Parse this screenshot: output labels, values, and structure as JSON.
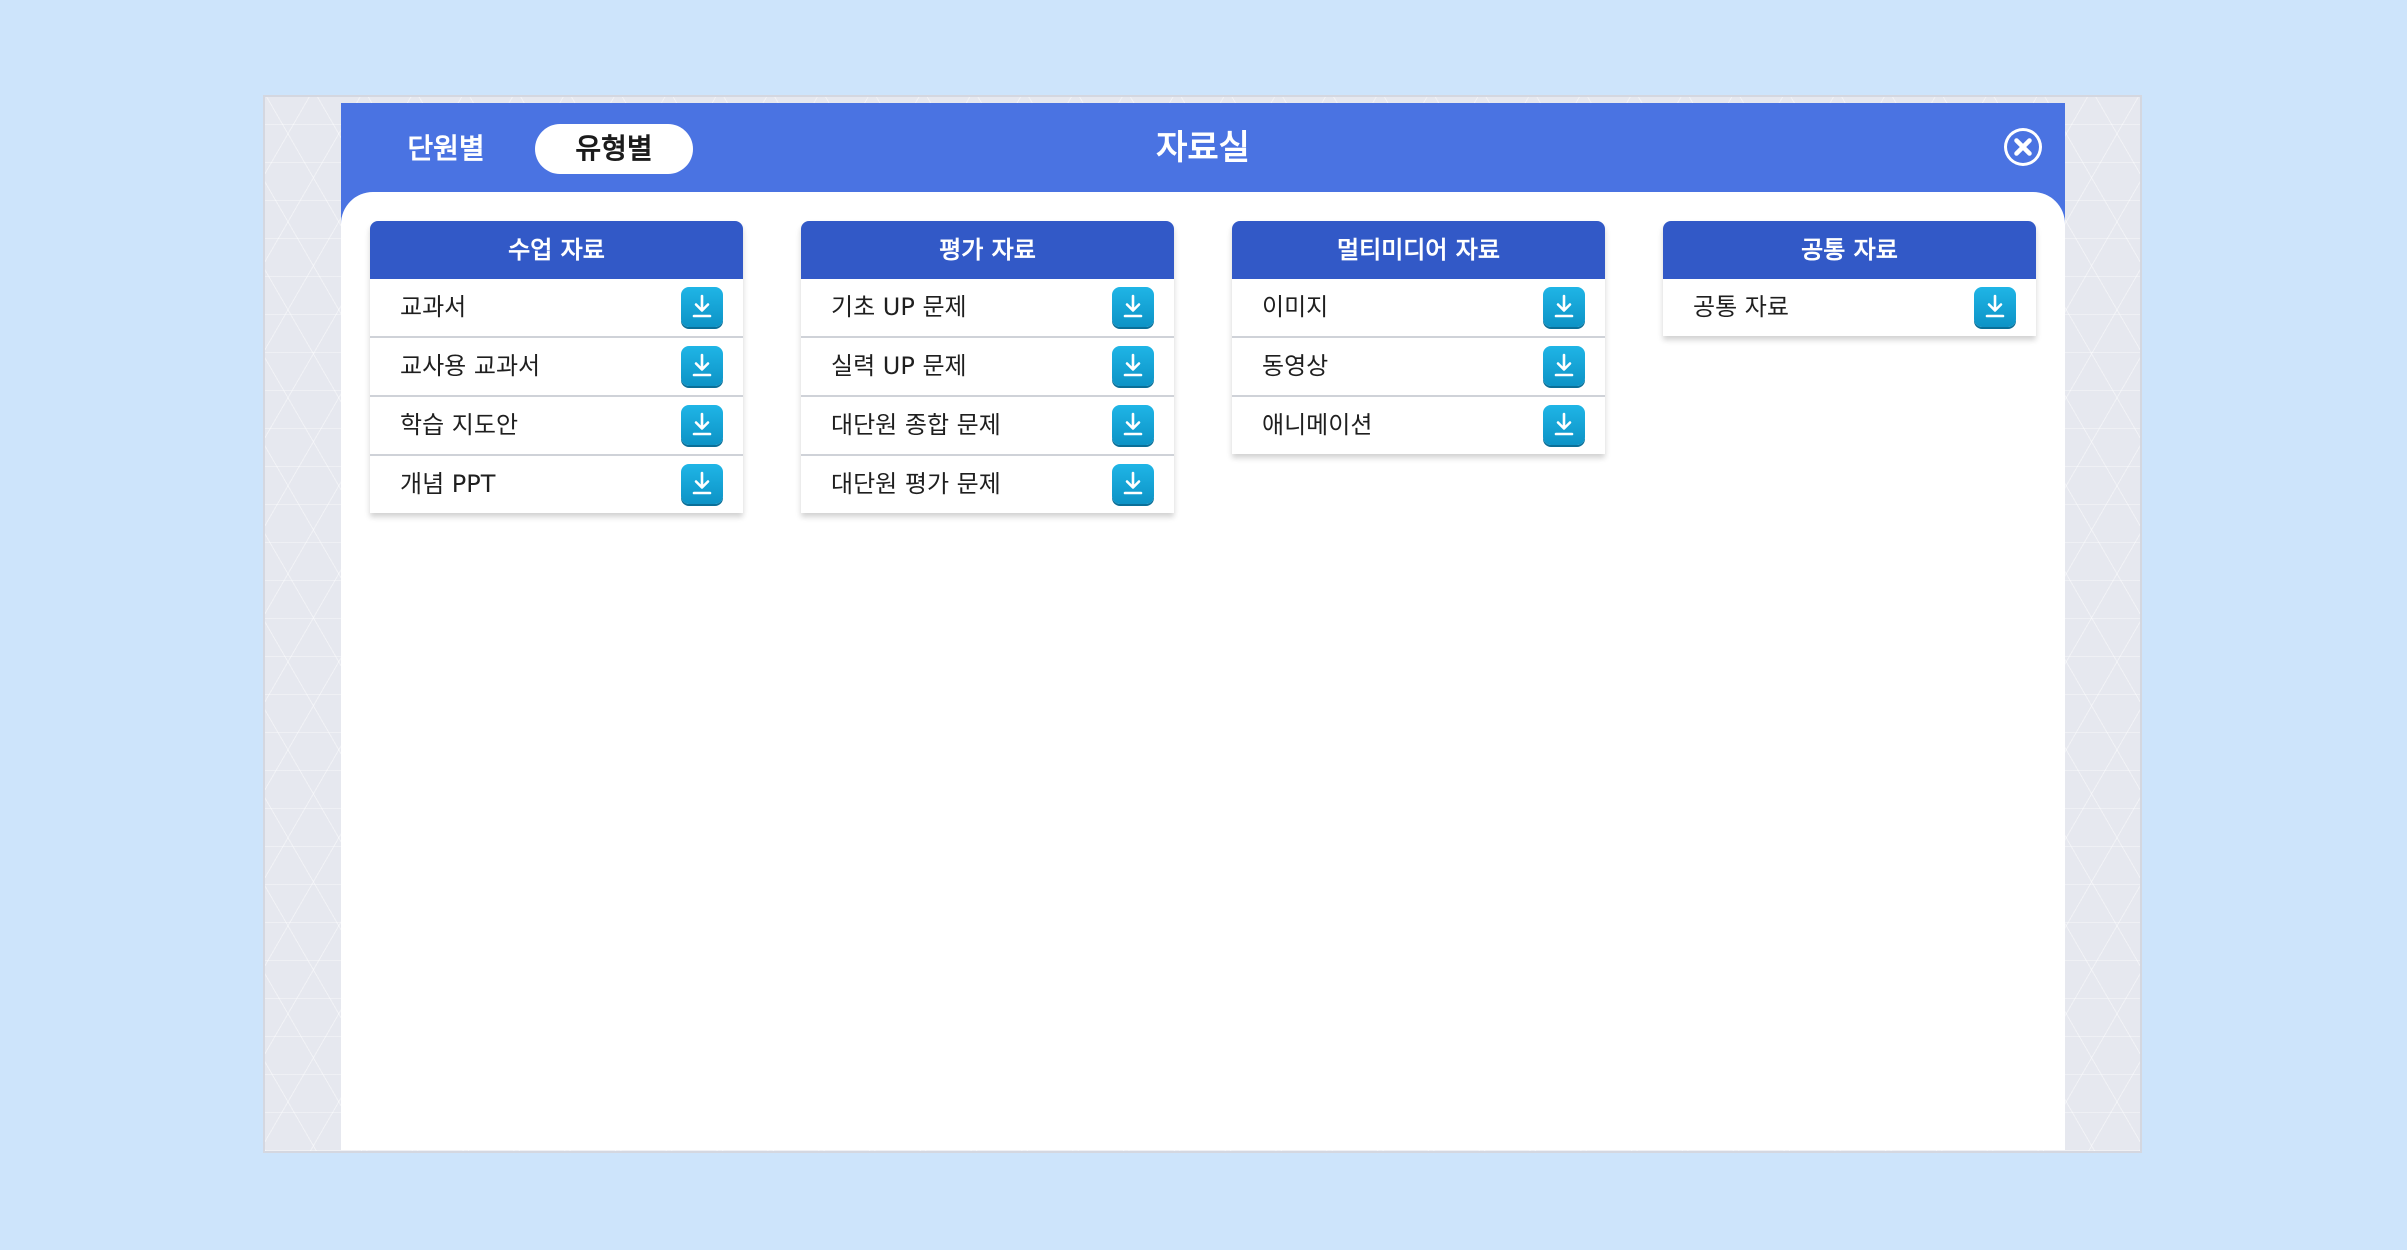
{
  "header": {
    "tabs": [
      {
        "label": "단원별",
        "active": false
      },
      {
        "label": "유형별",
        "active": true
      }
    ],
    "title": "자료실",
    "close_icon": "close-circle-icon"
  },
  "colors": {
    "page_background": "#cde4fb",
    "header_blue": "#4a73e2",
    "column_header_blue": "#3259c7",
    "download_button": "#1aa7d9"
  },
  "columns": [
    {
      "title": "수업 자료",
      "items": [
        {
          "label": "교과서",
          "icon": "download-icon"
        },
        {
          "label": "교사용 교과서",
          "icon": "download-icon"
        },
        {
          "label": "학습 지도안",
          "icon": "download-icon"
        },
        {
          "label": "개념 PPT",
          "icon": "download-icon"
        }
      ]
    },
    {
      "title": "평가 자료",
      "items": [
        {
          "label": "기초 UP 문제",
          "icon": "download-icon"
        },
        {
          "label": "실력 UP 문제",
          "icon": "download-icon"
        },
        {
          "label": "대단원 종합 문제",
          "icon": "download-icon"
        },
        {
          "label": "대단원 평가 문제",
          "icon": "download-icon"
        }
      ]
    },
    {
      "title": "멀티미디어 자료",
      "items": [
        {
          "label": "이미지",
          "icon": "download-icon"
        },
        {
          "label": "동영상",
          "icon": "download-icon"
        },
        {
          "label": "애니메이션",
          "icon": "download-icon"
        }
      ]
    },
    {
      "title": "공통 자료",
      "items": [
        {
          "label": "공통 자료",
          "icon": "download-icon"
        }
      ]
    }
  ]
}
